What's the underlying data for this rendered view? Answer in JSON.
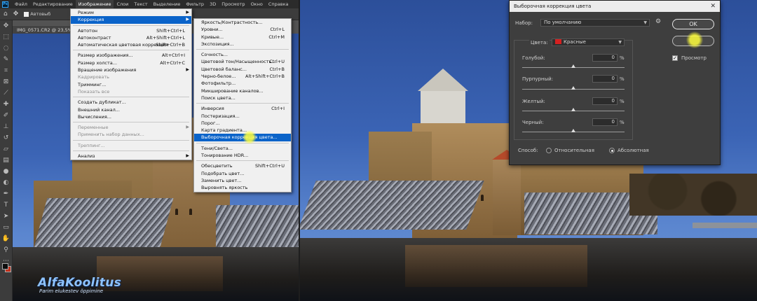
{
  "menubar": {
    "items": [
      "Файл",
      "Редактирование",
      "Изображение",
      "Слои",
      "Текст",
      "Выделение",
      "Фильтр",
      "3D",
      "Просмотр",
      "Окно",
      "Справка"
    ]
  },
  "optionsbar": {
    "auto_select_label": "Автовыб"
  },
  "document": {
    "tab_title": "IMG_0571.CR2 @ 23,5%"
  },
  "image_menu": {
    "items": [
      {
        "label": "Режим",
        "shortcut": "",
        "submenu": true
      },
      {
        "label": "Коррекция",
        "shortcut": "",
        "submenu": true,
        "highlighted": true
      },
      {
        "label": "Автотон",
        "shortcut": "Shift+Ctrl+L"
      },
      {
        "label": "Автоконтраст",
        "shortcut": "Alt+Shift+Ctrl+L"
      },
      {
        "label": "Автоматическая цветовая коррекция",
        "shortcut": "Shift+Ctrl+B"
      },
      {
        "label": "Размер изображения...",
        "shortcut": "Alt+Ctrl+I"
      },
      {
        "label": "Размер холста...",
        "shortcut": "Alt+Ctrl+C"
      },
      {
        "label": "Вращение изображения",
        "shortcut": "",
        "submenu": true
      },
      {
        "label": "Кадрировать",
        "shortcut": "",
        "disabled": true
      },
      {
        "label": "Тримминг...",
        "shortcut": ""
      },
      {
        "label": "Показать все",
        "shortcut": "",
        "disabled": true
      },
      {
        "label": "Создать дубликат...",
        "shortcut": ""
      },
      {
        "label": "Внешний канал...",
        "shortcut": ""
      },
      {
        "label": "Вычисления...",
        "shortcut": ""
      },
      {
        "label": "Переменные",
        "shortcut": "",
        "submenu": true,
        "disabled": true
      },
      {
        "label": "Применить набор данных...",
        "shortcut": "",
        "disabled": true
      },
      {
        "label": "Треппинг...",
        "shortcut": "",
        "disabled": true
      },
      {
        "label": "Анализ",
        "shortcut": "",
        "submenu": true
      }
    ]
  },
  "adjust_menu": {
    "items": [
      {
        "label": "Яркость/Контрастность...",
        "shortcut": ""
      },
      {
        "label": "Уровни...",
        "shortcut": "Ctrl+L"
      },
      {
        "label": "Кривые...",
        "shortcut": "Ctrl+M"
      },
      {
        "label": "Экспозиция...",
        "shortcut": ""
      },
      {
        "label": "Сочность...",
        "shortcut": ""
      },
      {
        "label": "Цветовой тон/Насыщенность...",
        "shortcut": "Ctrl+U"
      },
      {
        "label": "Цветовой баланс...",
        "shortcut": "Ctrl+B"
      },
      {
        "label": "Черно-белое...",
        "shortcut": "Alt+Shift+Ctrl+B"
      },
      {
        "label": "Фотофильтр...",
        "shortcut": ""
      },
      {
        "label": "Микширование каналов...",
        "shortcut": ""
      },
      {
        "label": "Поиск цвета...",
        "shortcut": ""
      },
      {
        "label": "Инверсия",
        "shortcut": "Ctrl+I"
      },
      {
        "label": "Постеризация...",
        "shortcut": ""
      },
      {
        "label": "Порог...",
        "shortcut": ""
      },
      {
        "label": "Карта градиента...",
        "shortcut": ""
      },
      {
        "label": "Выборочная коррекция цвета...",
        "shortcut": "",
        "highlighted": true
      },
      {
        "label": "Тени/Света...",
        "shortcut": ""
      },
      {
        "label": "Тонирование HDR...",
        "shortcut": ""
      },
      {
        "label": "Обесцветить",
        "shortcut": "Shift+Ctrl+U"
      },
      {
        "label": "Подобрать цвет...",
        "shortcut": ""
      },
      {
        "label": "Заменить цвет...",
        "shortcut": ""
      },
      {
        "label": "Выровнять яркость",
        "shortcut": ""
      }
    ]
  },
  "watermark": {
    "title": "AlfaKoolitus",
    "subtitle": "Parim elukestev õppimine"
  },
  "dialog": {
    "title": "Выборочная коррекция цвета",
    "preset_label": "Набор:",
    "preset_value": "По умолчанию",
    "colors_label": "Цвета:",
    "colors_value": "Красные",
    "sliders": [
      {
        "label": "Голубой:",
        "value": "0",
        "unit": "%"
      },
      {
        "label": "Пурпурный:",
        "value": "0",
        "unit": "%"
      },
      {
        "label": "Желтый:",
        "value": "0",
        "unit": "%"
      },
      {
        "label": "Черный:",
        "value": "0",
        "unit": "%"
      }
    ],
    "ok_label": "OK",
    "cancel_label": "Отмена",
    "preview_label": "Просмотр",
    "method_label": "Способ:",
    "relative_label": "Относительная",
    "absolute_label": "Абсолютная",
    "method_selected": "absolute",
    "preview_checked": true,
    "colors": {
      "chip": "#d42020"
    }
  }
}
